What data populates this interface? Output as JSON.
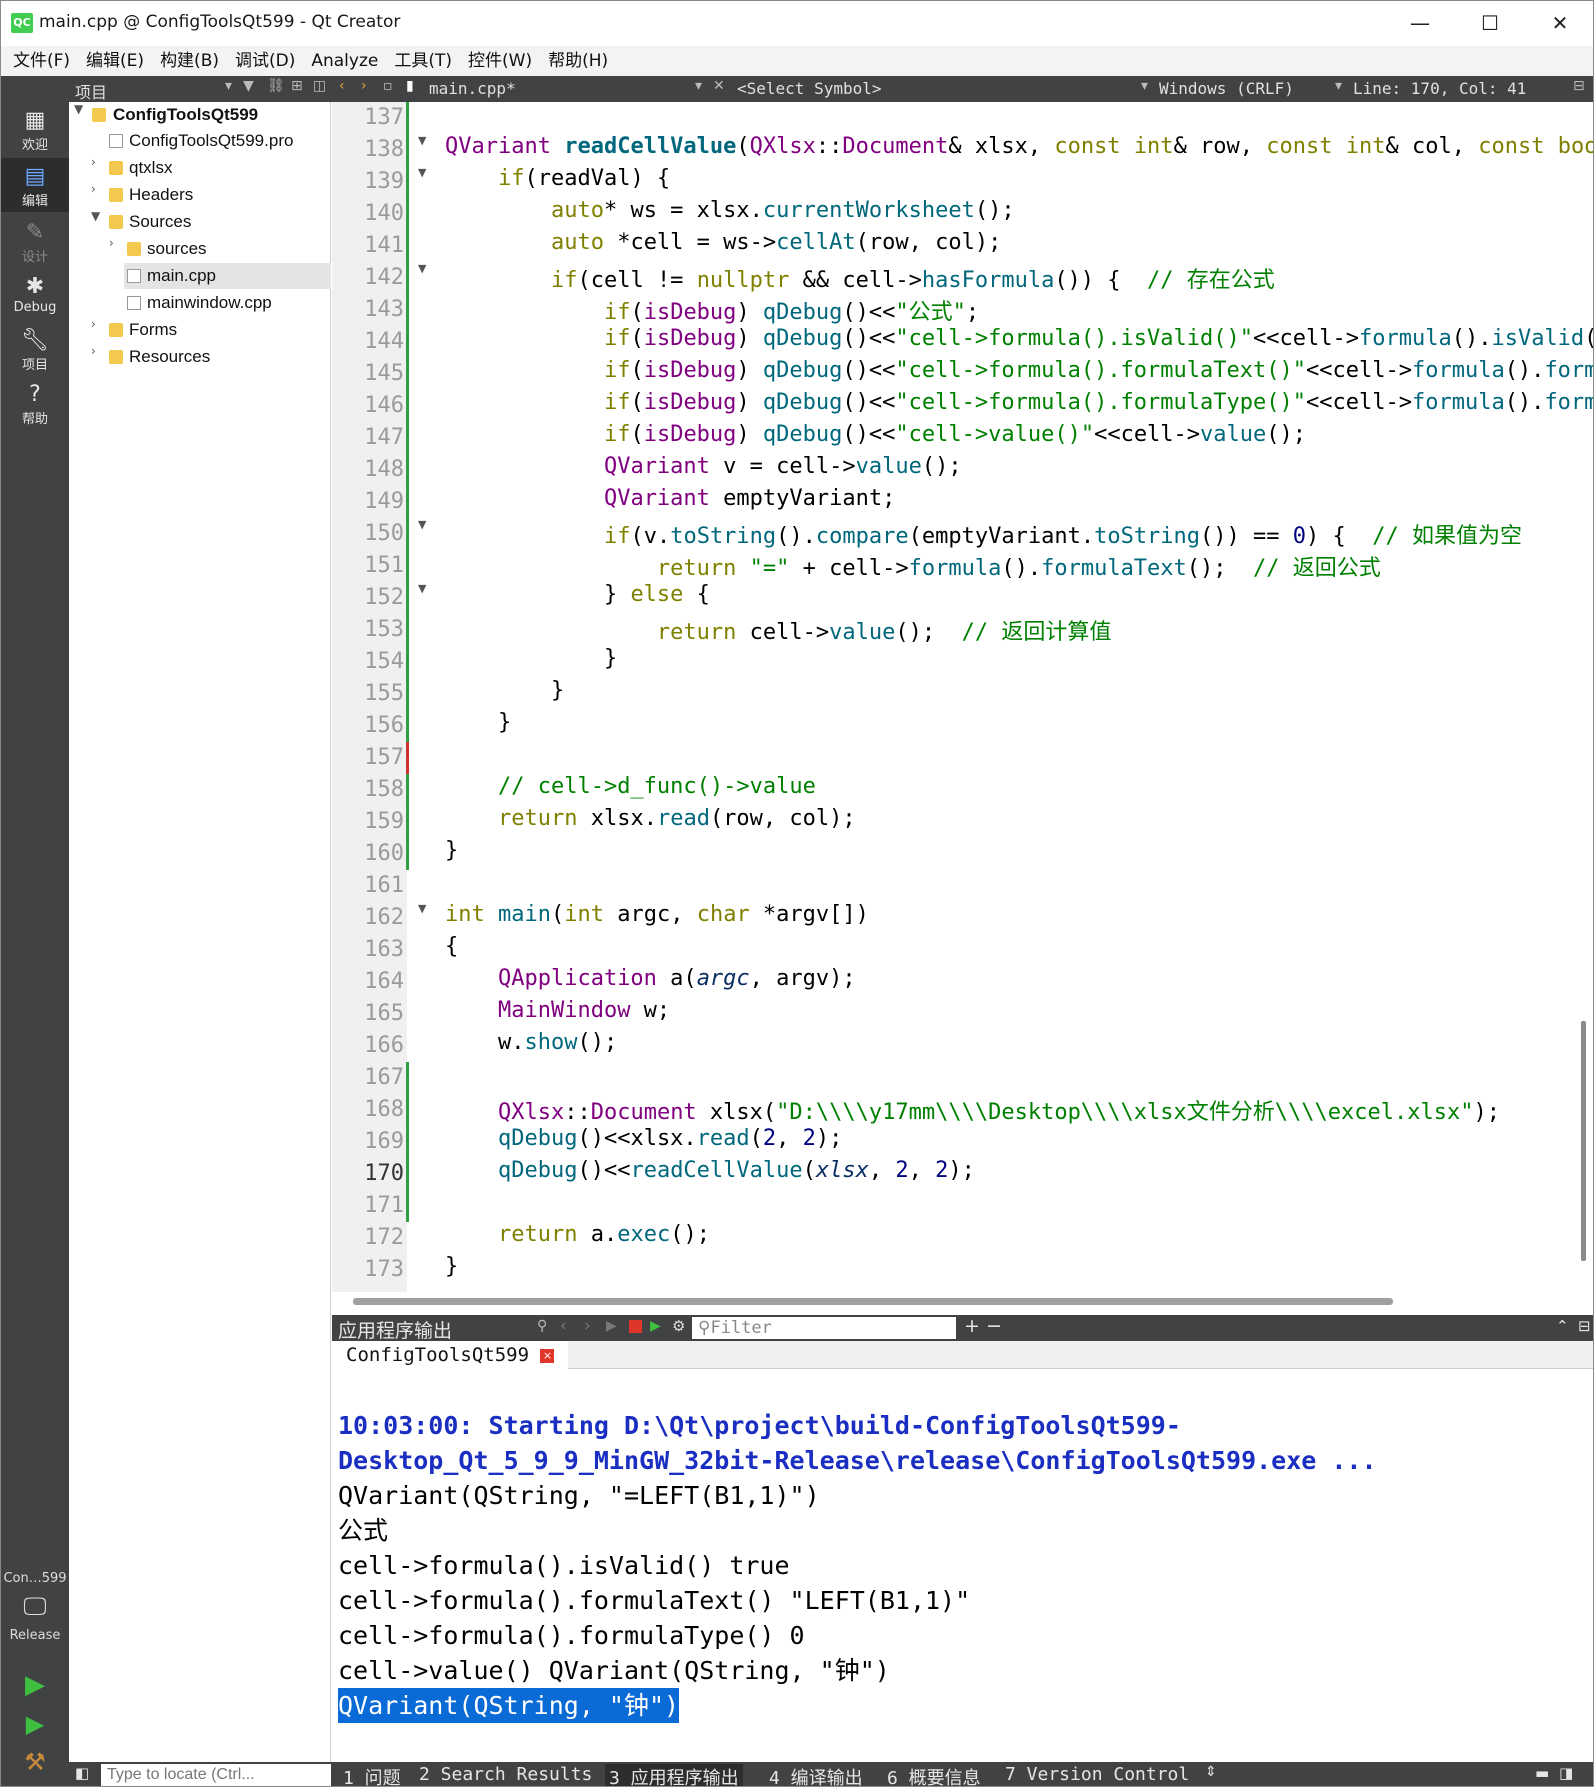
{
  "window": {
    "title": "main.cpp @ ConfigToolsQt599 - Qt Creator",
    "logo": "QC",
    "minimize": "—",
    "maximize": "☐",
    "close": "✕"
  },
  "menu": [
    "文件(F)",
    "编辑(E)",
    "构建(B)",
    "调试(D)",
    "Analyze",
    "工具(T)",
    "控件(W)",
    "帮助(H)"
  ],
  "toolbar": {
    "pane_title": "项目",
    "file_tab": "main.cpp*",
    "symbol": "<Select Symbol>",
    "line_ending": "Windows (CRLF)",
    "position": "Line: 170, Col: 41"
  },
  "modes": [
    {
      "label": "欢迎",
      "icon": "grid-icon"
    },
    {
      "label": "编辑",
      "icon": "edit-icon"
    },
    {
      "label": "设计",
      "icon": "pencil-icon"
    },
    {
      "label": "Debug",
      "icon": "bug-icon"
    },
    {
      "label": "项目",
      "icon": "wrench-icon"
    },
    {
      "label": "帮助",
      "icon": "help-icon"
    }
  ],
  "target": {
    "name": "Con…599",
    "config": "Release"
  },
  "tree": [
    {
      "label": "ConfigToolsQt599",
      "bold": true
    },
    {
      "label": "ConfigToolsQt599.pro"
    },
    {
      "label": "qtxlsx"
    },
    {
      "label": "Headers"
    },
    {
      "label": "Sources"
    },
    {
      "label": "sources"
    },
    {
      "label": "main.cpp"
    },
    {
      "label": "mainwindow.cpp"
    },
    {
      "label": "Forms"
    },
    {
      "label": "Resources"
    }
  ],
  "line_numbers": [
    "137",
    "138",
    "139",
    "140",
    "141",
    "142",
    "143",
    "144",
    "145",
    "146",
    "147",
    "148",
    "149",
    "150",
    "151",
    "152",
    "153",
    "154",
    "155",
    "156",
    "157",
    "158",
    "159",
    "160",
    "161",
    "162",
    "163",
    "164",
    "165",
    "166",
    "167",
    "168",
    "169",
    "170",
    "171",
    "172",
    "173"
  ],
  "output": {
    "title": "应用程序输出",
    "filter_placeholder": "Filter",
    "tab": "ConfigToolsQt599",
    "lines": [
      "10:03:00: Starting D:\\Qt\\project\\build-ConfigToolsQt599-",
      "Desktop_Qt_5_9_9_MinGW_32bit-Release\\release\\ConfigToolsQt599.exe ...",
      "QVariant(QString, \"=LEFT(B1,1)\")",
      "公式",
      "cell->formula().isValid() true",
      "cell->formula().formulaText() \"LEFT(B1,1)\"",
      "cell->formula().formulaType() 0",
      "cell->value() QVariant(QString, \"钟\")",
      "QVariant(QString, \"钟\")"
    ]
  },
  "status": {
    "locate_placeholder": "Type to locate (Ctrl...",
    "tabs": [
      "1 问题",
      "2 Search Results",
      "3 应用程序输出",
      "4 编译输出",
      "6 概要信息",
      "7 Version Control"
    ]
  }
}
